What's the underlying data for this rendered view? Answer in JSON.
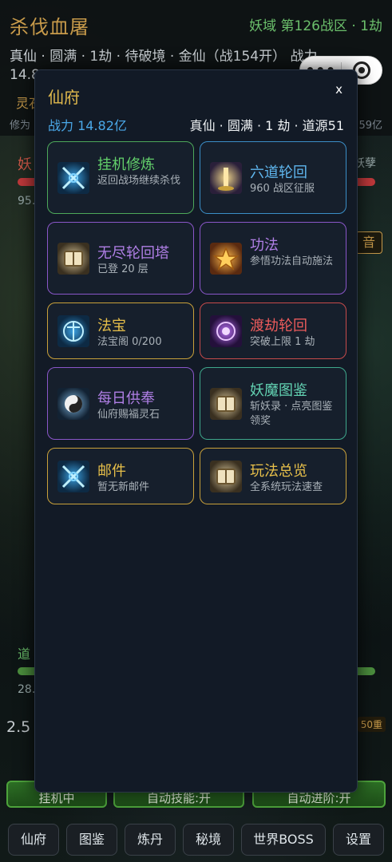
{
  "header": {
    "game_title": "杀伐血屠",
    "zone": "妖域 第126战区 · 1劫",
    "realm_line": "真仙 · 圆满 · 1劫 · 待破境 · 金仙（战154开） 战力",
    "power_partial": "14.8",
    "spirit_partial": "灵石",
    "cultivation_partial": "修为",
    "right_value": "59亿"
  },
  "capsule": {
    "menu_icon": "more-dots-icon",
    "close_icon": "target-icon"
  },
  "battle": {
    "enemy_name_partial": "妖",
    "enemy_right": "妖孽",
    "enemy_value_partial": "95.",
    "sound_label": "音",
    "self_name_partial": "道",
    "self_value_partial": "28.",
    "speed_partial": "2.5",
    "layer_badge": "50重"
  },
  "actions": [
    {
      "label": "挂机中"
    },
    {
      "label": "自动技能:开"
    },
    {
      "label": "自动进阶:开"
    }
  ],
  "nav": [
    {
      "label": "仙府"
    },
    {
      "label": "图鉴"
    },
    {
      "label": "炼丹"
    },
    {
      "label": "秘境"
    },
    {
      "label": "世界BOSS"
    },
    {
      "label": "设置"
    }
  ],
  "modal": {
    "title": "仙府",
    "close": "x",
    "power": "战力 14.82亿",
    "realm": "真仙 · 圆满 · 1 劫 · 道源51",
    "cards": [
      {
        "title": "挂机修炼",
        "desc": "返回战场继续杀伐",
        "icon": "crossed-swords-icon",
        "color": "green"
      },
      {
        "title": "六道轮回",
        "desc": "960 战区征服",
        "icon": "light-pillar-icon",
        "color": "blue"
      },
      {
        "title": "无尽轮回塔",
        "desc": "已登 20 层",
        "icon": "scroll-book-icon",
        "color": "purple"
      },
      {
        "title": "功法",
        "desc": "参悟功法自动施法",
        "icon": "golden-lotus-icon",
        "color": "purple"
      },
      {
        "title": "法宝",
        "desc": "法宝阁 0/200",
        "icon": "talisman-icon",
        "color": "gold"
      },
      {
        "title": "渡劫轮回",
        "desc": "突破上限 1 劫",
        "icon": "purple-vortex-icon",
        "color": "red"
      },
      {
        "title": "每日供奉",
        "desc": "仙府赐福灵石",
        "icon": "taiji-icon",
        "color": "purple"
      },
      {
        "title": "妖魔图鉴",
        "desc": "斩妖录 · 点亮图鉴领奖",
        "icon": "scroll-book-icon",
        "color": "teal"
      },
      {
        "title": "邮件",
        "desc": "暂无新邮件",
        "icon": "crossed-swords-icon",
        "color": "gold"
      },
      {
        "title": "玩法总览",
        "desc": "全系统玩法速查",
        "icon": "scroll-book-icon",
        "color": "gold"
      }
    ]
  }
}
